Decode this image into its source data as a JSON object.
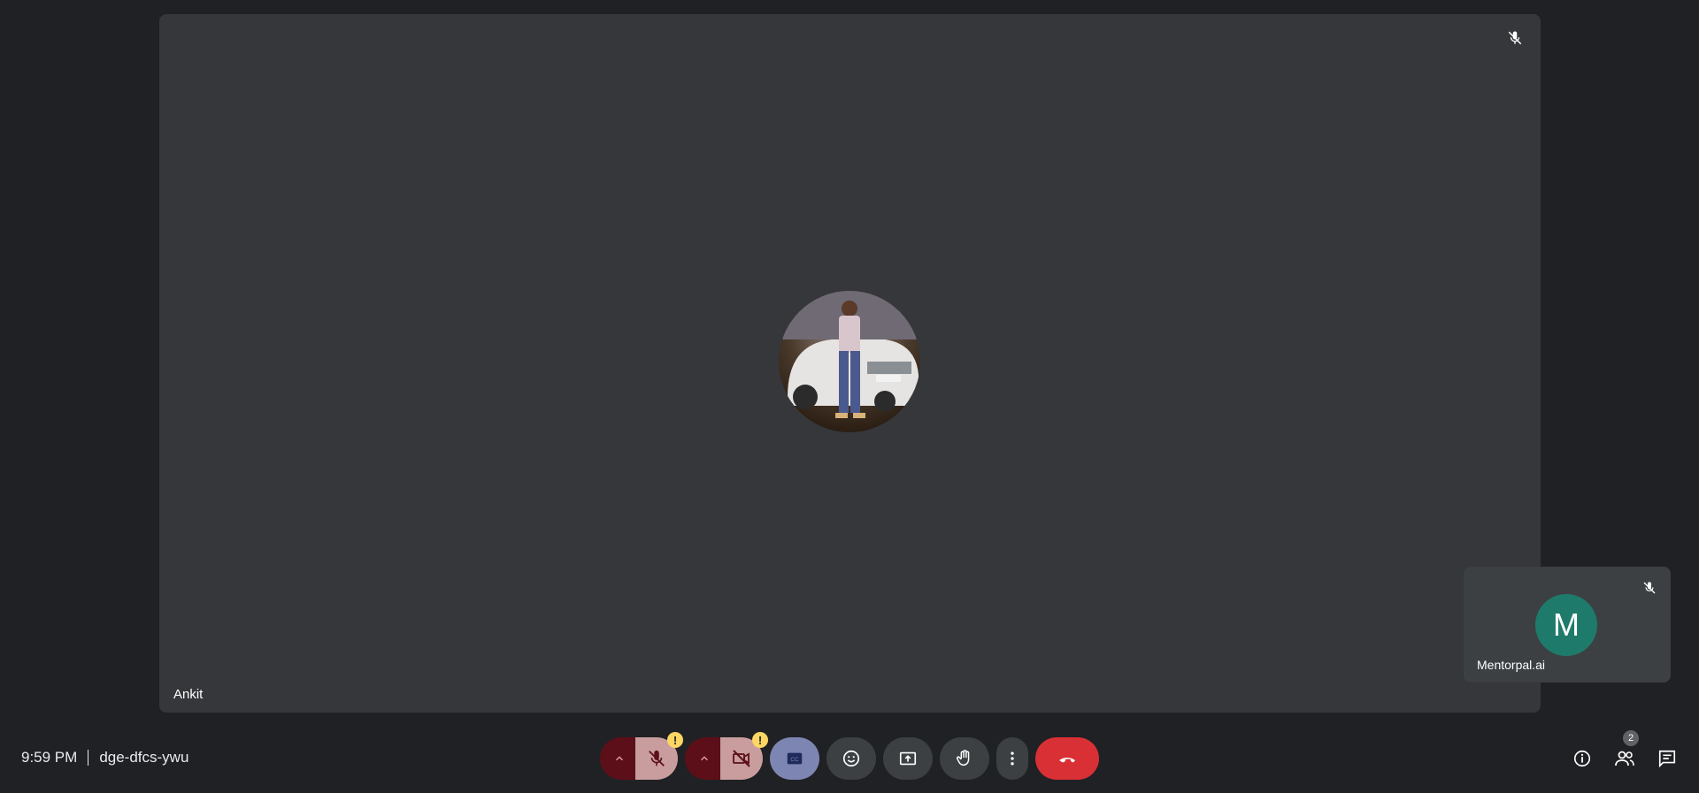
{
  "meeting": {
    "time": "9:59 PM",
    "code": "dge-dfcs-ywu"
  },
  "main_participant": {
    "name": "Ankit",
    "muted": true,
    "avatar": "photo-of-person-standing-by-white-car"
  },
  "self_participant": {
    "name": "Mentorpal.ai",
    "initial": "M",
    "avatar_color": "#1e7b6b",
    "muted": true
  },
  "controls": {
    "mic": {
      "state": "off",
      "warning": "!",
      "icon": "mic-off-icon"
    },
    "camera": {
      "state": "off",
      "warning": "!",
      "icon": "videocam-off-icon"
    },
    "captions": {
      "icon": "closed-captions-icon"
    },
    "reactions": {
      "icon": "emoji-icon"
    },
    "present": {
      "icon": "present-screen-icon"
    },
    "raise_hand": {
      "icon": "hand-icon"
    },
    "more": {
      "icon": "more-vert-icon"
    },
    "leave": {
      "icon": "call-end-icon"
    }
  },
  "right_panel": {
    "info_icon": "info-icon",
    "people_icon": "people-icon",
    "people_count": "2",
    "chat_icon": "chat-icon"
  },
  "colors": {
    "background": "#202124",
    "tile": "#35373a",
    "end_call": "#d93035",
    "mic_off_bg": "#c99d9e",
    "captions_bg": "#7d86b3",
    "warning": "#fdd663"
  }
}
